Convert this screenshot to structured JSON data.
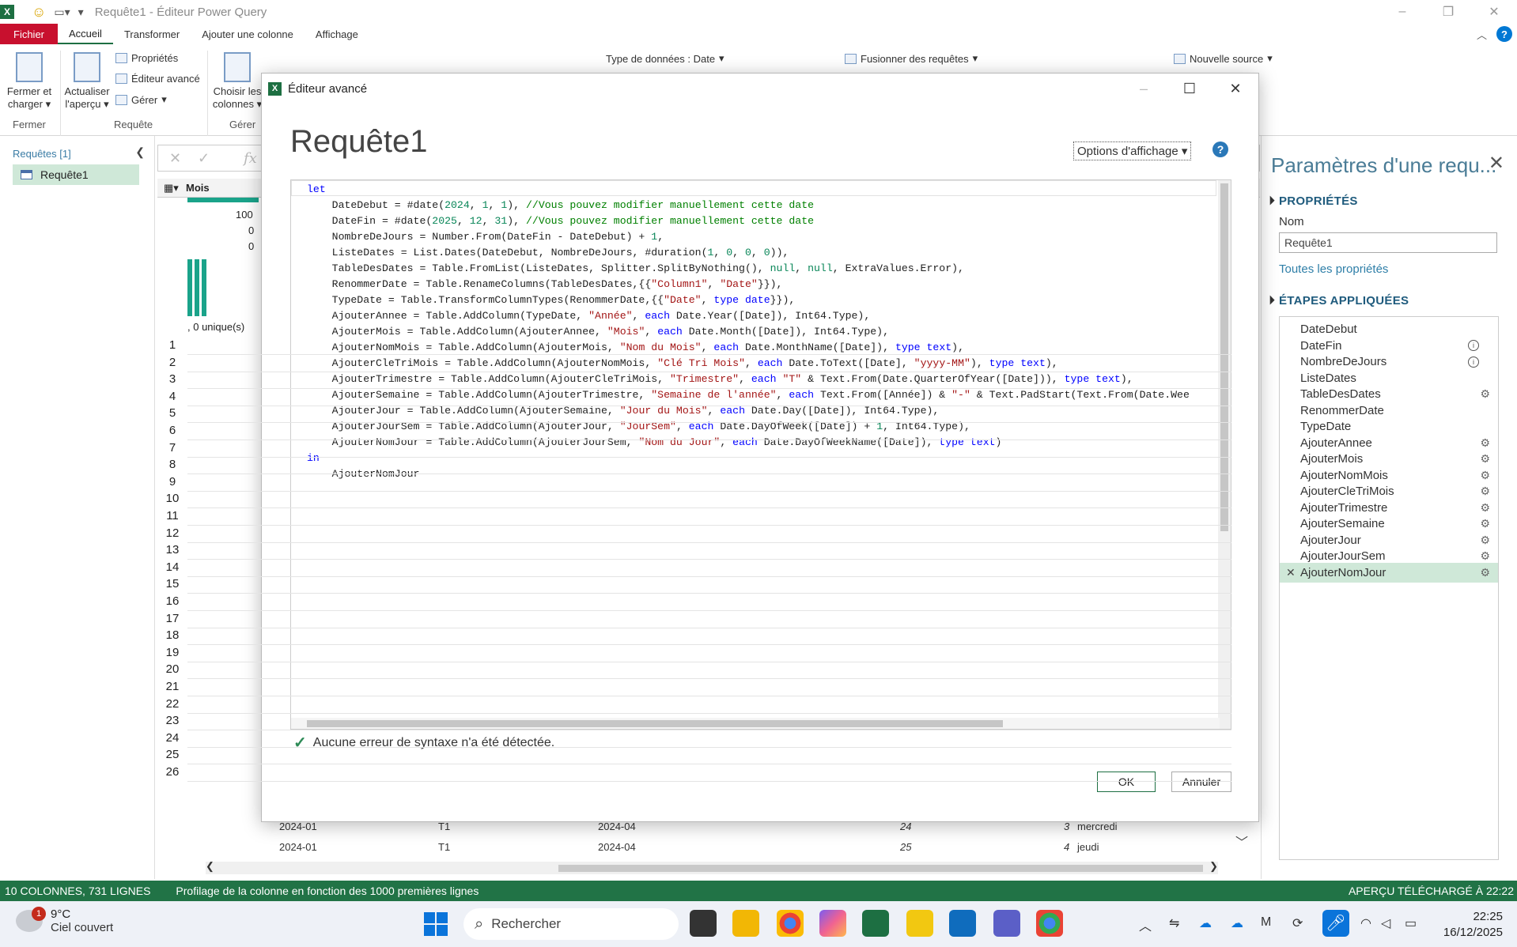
{
  "window": {
    "title": "Requête1 - Éditeur Power Query",
    "app_letter": "X"
  },
  "tabs": [
    "Fichier",
    "Accueil",
    "Transformer",
    "Ajouter une colonne",
    "Affichage"
  ],
  "ribbon": {
    "fermer_charger": "Fermer et charger",
    "actualiser": "Actualiser l'aperçu",
    "proprietes": "Propriétés",
    "editeur_avance": "Éditeur avancé",
    "gerer": "Gérer",
    "choisir_colonnes": "Choisir les colonnes",
    "type_donnees": "Type de données : Date",
    "fusionner": "Fusionner des requêtes",
    "nouvelle_source": "Nouvelle source",
    "groups": {
      "fermer": "Fermer",
      "requete": "Requête",
      "gerer": "Gérer"
    }
  },
  "left_pane": {
    "header": "Requêtes [1]",
    "query": "Requête1"
  },
  "grid": {
    "col_header": "Mois",
    "profile_values": [
      "100",
      "0",
      "0"
    ],
    "unique_text": ", 0 unique(s)",
    "row_numbers": [
      "1",
      "2",
      "3",
      "4",
      "5",
      "6",
      "7",
      "8",
      "9",
      "10",
      "11",
      "12",
      "13",
      "14",
      "15",
      "16",
      "17",
      "18",
      "19",
      "20",
      "21",
      "22",
      "23",
      "24",
      "25",
      "26"
    ],
    "row24": [
      "2024-01",
      "T1",
      "2024-04",
      "24",
      "3",
      "mercredi"
    ],
    "row25": [
      "2024-01",
      "T1",
      "2024-04",
      "25",
      "4",
      "jeudi"
    ]
  },
  "right_pane": {
    "title": "Paramètres d'une requ...",
    "proprietes_header": "PROPRIÉTÉS",
    "nom_label": "Nom",
    "nom_value": "Requête1",
    "toutes_proprietes": "Toutes les propriétés",
    "etapes_header": "ÉTAPES APPLIQUÉES",
    "steps": [
      {
        "label": "DateDebut",
        "icon": "none"
      },
      {
        "label": "DateFin",
        "icon": "info-icon"
      },
      {
        "label": "NombreDeJours",
        "icon": "info-icon"
      },
      {
        "label": "ListeDates",
        "icon": "none"
      },
      {
        "label": "TableDesDates",
        "icon": "gear-icon"
      },
      {
        "label": "RenommerDate",
        "icon": "none"
      },
      {
        "label": "TypeDate",
        "icon": "none"
      },
      {
        "label": "AjouterAnnee",
        "icon": "gear-icon"
      },
      {
        "label": "AjouterMois",
        "icon": "gear-icon"
      },
      {
        "label": "AjouterNomMois",
        "icon": "gear-icon"
      },
      {
        "label": "AjouterCleTriMois",
        "icon": "gear-icon"
      },
      {
        "label": "AjouterTrimestre",
        "icon": "gear-icon"
      },
      {
        "label": "AjouterSemaine",
        "icon": "gear-icon"
      },
      {
        "label": "AjouterJour",
        "icon": "gear-icon"
      },
      {
        "label": "AjouterJourSem",
        "icon": "gear-icon"
      },
      {
        "label": "AjouterNomJour",
        "icon": "gear-icon",
        "selected": true
      }
    ]
  },
  "status": {
    "left1": "10 COLONNES, 731 LIGNES",
    "left2": "Profilage de la colonne en fonction des 1000 premières lignes",
    "right": "APERÇU TÉLÉCHARGÉ À 22:22"
  },
  "taskbar": {
    "weather_temp": "9°C",
    "weather_desc": "Ciel couvert",
    "weather_badge": "1",
    "search_placeholder": "Rechercher",
    "time": "22:25",
    "date": "16/12/2025"
  },
  "dialog": {
    "title": "Éditeur avancé",
    "heading": "Requête1",
    "view_options": "Options d'affichage",
    "syntax_msg": "Aucune erreur de syntaxe n'a été détectée.",
    "ok": "OK",
    "cancel": "Annuler",
    "code_lines": [
      [
        [
          "kw",
          "let"
        ]
      ],
      [
        [
          "t",
          "    DateDebut = #date("
        ],
        [
          "nm",
          "2024"
        ],
        [
          "t",
          ", "
        ],
        [
          "nm",
          "1"
        ],
        [
          "t",
          ", "
        ],
        [
          "nm",
          "1"
        ],
        [
          "t",
          "), "
        ],
        [
          "cm",
          "//Vous pouvez modifier manuellement cette date"
        ]
      ],
      [
        [
          "t",
          "    DateFin = #date("
        ],
        [
          "nm",
          "2025"
        ],
        [
          "t",
          ", "
        ],
        [
          "nm",
          "12"
        ],
        [
          "t",
          ", "
        ],
        [
          "nm",
          "31"
        ],
        [
          "t",
          "), "
        ],
        [
          "cm",
          "//Vous pouvez modifier manuellement cette date"
        ]
      ],
      [
        [
          "t",
          "    NombreDeJours = Number.From(DateFin - DateDebut) + "
        ],
        [
          "nm",
          "1"
        ],
        [
          "t",
          ","
        ]
      ],
      [
        [
          "t",
          "    ListeDates = List.Dates(DateDebut, NombreDeJours, #duration("
        ],
        [
          "nm",
          "1"
        ],
        [
          "t",
          ", "
        ],
        [
          "nm",
          "0"
        ],
        [
          "t",
          ", "
        ],
        [
          "nm",
          "0"
        ],
        [
          "t",
          ", "
        ],
        [
          "nm",
          "0"
        ],
        [
          "t",
          ")),"
        ]
      ],
      [
        [
          "t",
          "    TableDesDates = Table.FromList(ListeDates, Splitter.SplitByNothing(), "
        ],
        [
          "nm",
          "null"
        ],
        [
          "t",
          ", "
        ],
        [
          "nm",
          "null"
        ],
        [
          "t",
          ", ExtraValues.Error),"
        ]
      ],
      [
        [
          "t",
          "    RenommerDate = Table.RenameColumns(TableDesDates,{{"
        ],
        [
          "st",
          "\"Column1\""
        ],
        [
          "t",
          ", "
        ],
        [
          "st",
          "\"Date\""
        ],
        [
          "t",
          "}}),"
        ]
      ],
      [
        [
          "t",
          "    TypeDate = Table.TransformColumnTypes(RenommerDate,{{"
        ],
        [
          "st",
          "\"Date\""
        ],
        [
          "t",
          ", "
        ],
        [
          "kw",
          "type date"
        ],
        [
          "t",
          "}}),"
        ]
      ],
      [
        [
          "t",
          "    AjouterAnnee = Table.AddColumn(TypeDate, "
        ],
        [
          "st",
          "\"Année\""
        ],
        [
          "t",
          ", "
        ],
        [
          "kw",
          "each"
        ],
        [
          "t",
          " Date.Year([Date]), Int64.Type),"
        ]
      ],
      [
        [
          "t",
          "    AjouterMois = Table.AddColumn(AjouterAnnee, "
        ],
        [
          "st",
          "\"Mois\""
        ],
        [
          "t",
          ", "
        ],
        [
          "kw",
          "each"
        ],
        [
          "t",
          " Date.Month([Date]), Int64.Type),"
        ]
      ],
      [
        [
          "t",
          "    AjouterNomMois = Table.AddColumn(AjouterMois, "
        ],
        [
          "st",
          "\"Nom du Mois\""
        ],
        [
          "t",
          ", "
        ],
        [
          "kw",
          "each"
        ],
        [
          "t",
          " Date.MonthName([Date]), "
        ],
        [
          "kw",
          "type text"
        ],
        [
          "t",
          "),"
        ]
      ],
      [
        [
          "t",
          "    AjouterCleTriMois = Table.AddColumn(AjouterNomMois, "
        ],
        [
          "st",
          "\"Clé Tri Mois\""
        ],
        [
          "t",
          ", "
        ],
        [
          "kw",
          "each"
        ],
        [
          "t",
          " Date.ToText([Date], "
        ],
        [
          "st",
          "\"yyyy-MM\""
        ],
        [
          "t",
          "), "
        ],
        [
          "kw",
          "type text"
        ],
        [
          "t",
          "),"
        ]
      ],
      [
        [
          "t",
          "    AjouterTrimestre = Table.AddColumn(AjouterCleTriMois, "
        ],
        [
          "st",
          "\"Trimestre\""
        ],
        [
          "t",
          ", "
        ],
        [
          "kw",
          "each"
        ],
        [
          "t",
          " "
        ],
        [
          "st",
          "\"T\""
        ],
        [
          "t",
          " & Text.From(Date.QuarterOfYear([Date])), "
        ],
        [
          "kw",
          "type text"
        ],
        [
          "t",
          "),"
        ]
      ],
      [
        [
          "t",
          "    AjouterSemaine = Table.AddColumn(AjouterTrimestre, "
        ],
        [
          "st",
          "\"Semaine de l'année\""
        ],
        [
          "t",
          ", "
        ],
        [
          "kw",
          "each"
        ],
        [
          "t",
          " Text.From([Année]) & "
        ],
        [
          "st",
          "\"-\""
        ],
        [
          "t",
          " & Text.PadStart(Text.From(Date.Wee"
        ]
      ],
      [
        [
          "t",
          "    AjouterJour = Table.AddColumn(AjouterSemaine, "
        ],
        [
          "st",
          "\"Jour du Mois\""
        ],
        [
          "t",
          ", "
        ],
        [
          "kw",
          "each"
        ],
        [
          "t",
          " Date.Day([Date]), Int64.Type),"
        ]
      ],
      [
        [
          "t",
          "    AjouterJourSem = Table.AddColumn(AjouterJour, "
        ],
        [
          "st",
          "\"JourSem\""
        ],
        [
          "t",
          ", "
        ],
        [
          "kw",
          "each"
        ],
        [
          "t",
          " Date.DayOfWeek([Date]) + "
        ],
        [
          "nm",
          "1"
        ],
        [
          "t",
          ", Int64.Type),"
        ]
      ],
      [
        [
          "t",
          "    AjouterNomJour = Table.AddColumn(AjouterJourSem, "
        ],
        [
          "st",
          "\"Nom du Jour\""
        ],
        [
          "t",
          ", "
        ],
        [
          "kw",
          "each"
        ],
        [
          "t",
          " Date.DayOfWeekName([Date]), "
        ],
        [
          "kw",
          "type text"
        ],
        [
          "t",
          ")"
        ]
      ],
      [
        [
          "kw",
          "in"
        ]
      ],
      [
        [
          "t",
          "    AjouterNomJour"
        ]
      ]
    ]
  }
}
